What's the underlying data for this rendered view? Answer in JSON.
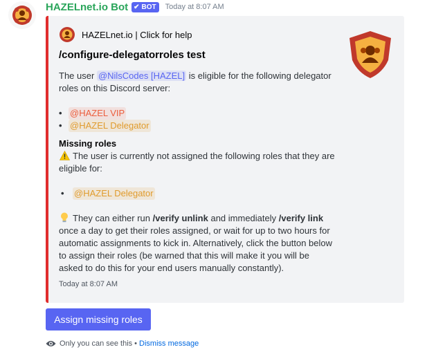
{
  "message": {
    "bot_name": "HAZELnet.io Bot",
    "bot_tag": "BOT",
    "timestamp": "Today at 8:07 AM"
  },
  "embed": {
    "accent_color": "#e02d2d",
    "author": "HAZELnet.io | Click for help",
    "title": "/configure-delegatorroles test",
    "desc_prefix": "The user",
    "user_mention": "@NilsCodes [HAZEL]",
    "desc_suffix": "is eligible for the following delegator roles on this Discord server:",
    "eligible_roles": [
      "@HAZEL VIP",
      "@HAZEL Delegator"
    ],
    "missing_title": "Missing roles",
    "missing_text": "The user is currently not assigned the following roles that they are eligible for:",
    "missing_roles": [
      "@HAZEL Delegator"
    ],
    "hint_1": "They can either run",
    "cmd_unlink": "/verify unlink",
    "hint_2": "and immediately",
    "cmd_link": "/verify link",
    "hint_3": "once a day to get their roles assigned, or wait for up to two hours for automatic assignments to kick in. Alternatively, click the button below to assign their roles (be warned that this will make it you will be asked to do this for your end users manually constantly).",
    "footer_time": "Today at 8:07 AM"
  },
  "button": {
    "label": "Assign missing roles"
  },
  "ephemeral": {
    "text": "Only you can see this",
    "separator": "•",
    "dismiss": "Dismiss message"
  },
  "colors": {
    "bot_name": "#2aa55a",
    "blurple": "#5865f2",
    "role_vip": "#ec5d3c",
    "role_delegator": "#e09b2d",
    "link": "#0068e0"
  },
  "icons": {
    "avatar": "hazel-logo-icon",
    "verified": "check-icon",
    "warning": "warning-icon",
    "bulb": "lightbulb-icon",
    "eye": "eye-icon",
    "thumbnail": "shield-logo-icon"
  }
}
